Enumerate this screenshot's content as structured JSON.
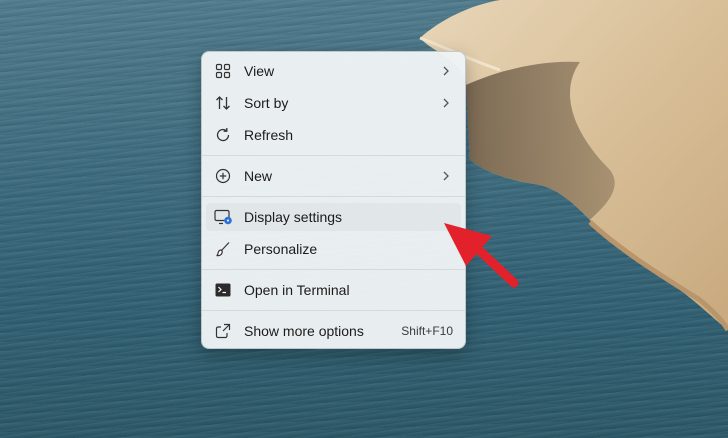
{
  "menu": {
    "items": [
      {
        "label": "View",
        "icon": "view-grid-icon",
        "has_submenu": true
      },
      {
        "label": "Sort by",
        "icon": "sort-icon",
        "has_submenu": true
      },
      {
        "label": "Refresh",
        "icon": "refresh-icon",
        "has_submenu": false
      },
      {
        "label": "New",
        "icon": "new-plus-icon",
        "has_submenu": true
      },
      {
        "label": "Display settings",
        "icon": "display-settings-icon",
        "has_submenu": false,
        "highlighted": true
      },
      {
        "label": "Personalize",
        "icon": "brush-icon",
        "has_submenu": false
      },
      {
        "label": "Open in Terminal",
        "icon": "terminal-icon",
        "has_submenu": false
      },
      {
        "label": "Show more options",
        "icon": "show-more-icon",
        "shortcut": "Shift+F10"
      }
    ]
  },
  "colors": {
    "accent": "#2f6fd8",
    "annotation_arrow": "#e3212b",
    "water": "#3d6d80",
    "sand": "#d9c2a0"
  }
}
